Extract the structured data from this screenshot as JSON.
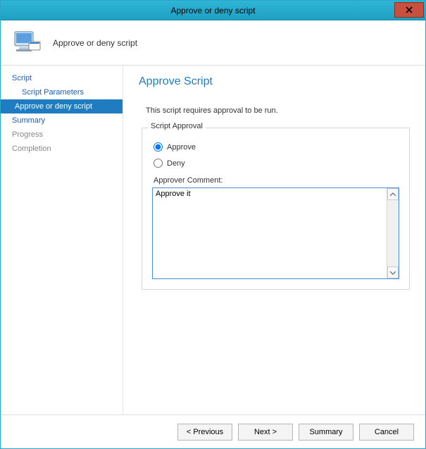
{
  "titlebar": {
    "title": "Approve or deny script"
  },
  "header": {
    "subtitle": "Approve or deny script"
  },
  "sidebar": {
    "items": [
      {
        "label": "Script",
        "indent": 0,
        "state": "link"
      },
      {
        "label": "Script Parameters",
        "indent": 1,
        "state": "link"
      },
      {
        "label": "Approve or deny script",
        "indent": 2,
        "state": "selected"
      },
      {
        "label": "Summary",
        "indent": 0,
        "state": "link"
      },
      {
        "label": "Progress",
        "indent": 0,
        "state": "inactive"
      },
      {
        "label": "Completion",
        "indent": 0,
        "state": "inactive"
      }
    ]
  },
  "main": {
    "title": "Approve Script",
    "instruction": "This script requires approval to be run.",
    "group_label": "Script Approval",
    "approve_label": "Approve",
    "deny_label": "Deny",
    "approval_selected": "approve",
    "comment_label": "Approver Comment:",
    "comment_value": "Approve it"
  },
  "footer": {
    "previous": "< Previous",
    "next": "Next >",
    "summary": "Summary",
    "cancel": "Cancel"
  }
}
